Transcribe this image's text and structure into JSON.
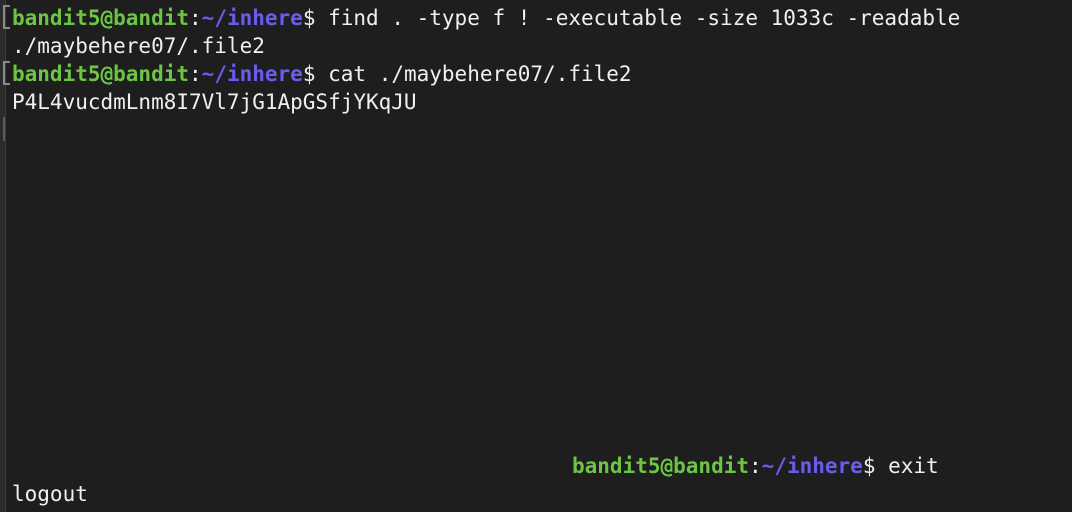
{
  "prompt": {
    "user_host": "bandit5@bandit",
    "colon": ":",
    "path": "~/inhere",
    "dollar": "$ "
  },
  "lines": {
    "cmd1": "find . -type f ! -executable -size 1033c -readable",
    "out1": "./maybehere07/.file2",
    "cmd2": "cat ./maybehere07/.file2",
    "out2": "P4L4vucdmLnm8I7Vl7jG1ApGSfjYKqJU",
    "cmd3": "exit",
    "out3": "logout"
  },
  "colors": {
    "background": "#1e1e1e",
    "user_host": "#6cc644",
    "path": "#6b5cf0",
    "text": "#f0f0f0"
  }
}
